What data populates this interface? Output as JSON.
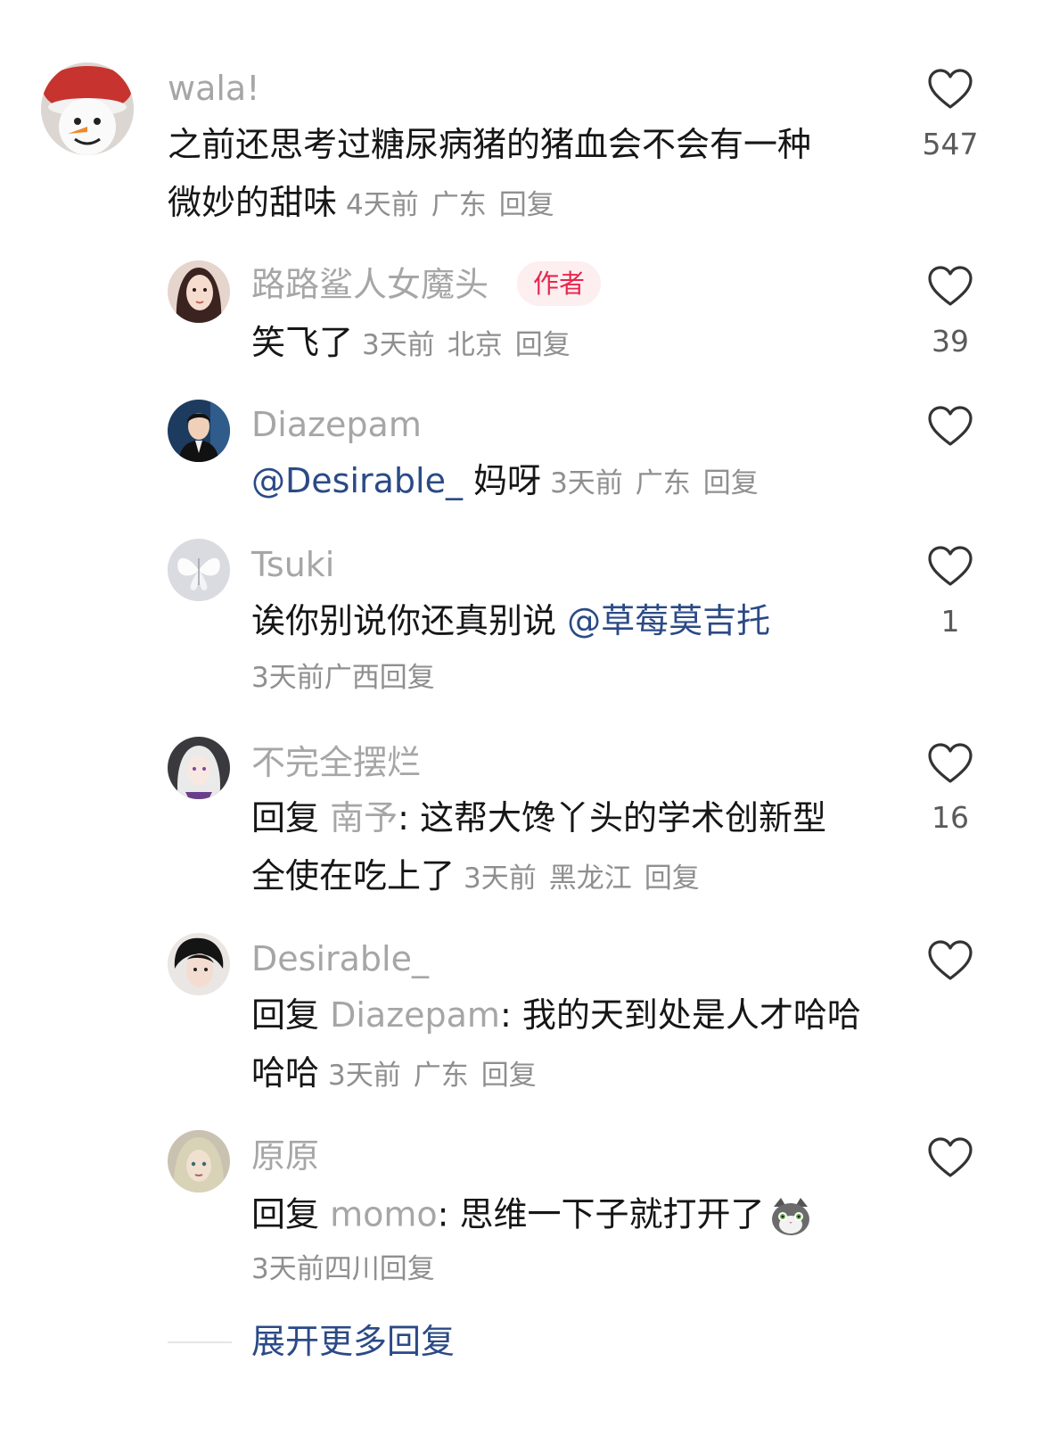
{
  "top_comment": {
    "username": "wala!",
    "line1": "之前还思考过糖尿病猪的猪血会不会有一种",
    "line2": "微妙的甜味",
    "time": "4天前",
    "location": "广东",
    "reply_label": "回复",
    "likes": "547"
  },
  "replies": [
    {
      "username": "路路鲨人女魔头",
      "badge": "作者",
      "text": "笑飞了",
      "time": "3天前",
      "location": "北京",
      "reply_label": "回复",
      "likes": "39"
    },
    {
      "username": "Diazepam",
      "mention": "@Desirable_",
      "text": " 妈呀",
      "time": "3天前",
      "location": "广东",
      "reply_label": "回复",
      "likes": ""
    },
    {
      "username": "Tsuki",
      "text": "诶你别说你还真别说 ",
      "mention": "@草莓莫吉托",
      "time": "3天前",
      "location": "广西",
      "reply_label": "回复",
      "likes": "1"
    },
    {
      "username": "不完全摆烂",
      "reply_prefix": "回复 ",
      "reply_target": "南予",
      "text_line1": ": 这帮大馋丫头的学术创新型",
      "text_line2": "全使在吃上了",
      "time": "3天前",
      "location": "黑龙江",
      "reply_label": "回复",
      "likes": "16"
    },
    {
      "username": "Desirable_",
      "reply_prefix": "回复 ",
      "reply_target": "Diazepam",
      "text_line1": ": 我的天到处是人才哈哈",
      "text_line2": "哈哈",
      "time": "3天前",
      "location": "广东",
      "reply_label": "回复",
      "likes": ""
    },
    {
      "username": "原原",
      "reply_prefix": "回复 ",
      "reply_target": "momo",
      "text_line1": ": 思维一下子就打开了",
      "emoji": "cat-face-emoji",
      "time": "3天前",
      "location": "四川",
      "reply_label": "回复",
      "likes": ""
    }
  ],
  "expand_more": "展开更多回复",
  "colors": {
    "mention": "#2b4a86",
    "author_badge_bg": "#fdeef0",
    "author_badge_text": "#e8264d",
    "meta": "#8f8f8f"
  },
  "icons": [
    "heart-outline-icon"
  ]
}
